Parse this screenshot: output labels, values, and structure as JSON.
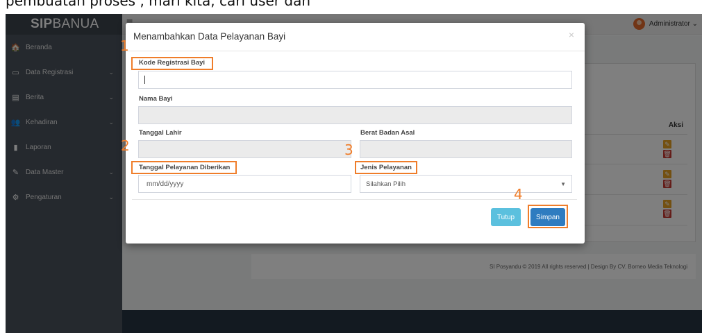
{
  "caption": "pembuatan proses , mari kita, cari user dan",
  "brand": {
    "bold": "SIP",
    "light": "BANUA"
  },
  "sidebar": {
    "items": [
      {
        "label": "Beranda",
        "icon": "home-icon",
        "glyph": "🏠",
        "has_children": false
      },
      {
        "label": "Data Registrasi",
        "icon": "monitor-icon",
        "glyph": "▭",
        "has_children": true
      },
      {
        "label": "Berita",
        "icon": "newspaper-icon",
        "glyph": "▤",
        "has_children": true
      },
      {
        "label": "Kehadiran",
        "icon": "users-icon",
        "glyph": "👥",
        "has_children": true
      },
      {
        "label": "Laporan",
        "icon": "file-icon",
        "glyph": "▮",
        "has_children": false
      },
      {
        "label": "Data Master",
        "icon": "edit-icon",
        "glyph": "✎",
        "has_children": true
      },
      {
        "label": "Pengaturan",
        "icon": "gear-icon",
        "glyph": "⚙",
        "has_children": true
      }
    ],
    "chevron": "⌄"
  },
  "topbar": {
    "menu_glyph": "≡",
    "user": "Administrator ⌄"
  },
  "table": {
    "aksi_header": "Aksi",
    "edit_glyph": "✎",
    "delete_glyph": "🗑"
  },
  "footer": {
    "text": "SI Posyandu © 2019 All rights reserved | Design By CV. Borneo Media Teknologi"
  },
  "modal": {
    "title": "Menambahkan Data Pelayanan Bayi",
    "close": "×",
    "fields": {
      "kode_label": "Kode Registrasi Bayi",
      "kode_value": "",
      "nama_label": "Nama Bayi",
      "tgl_lahir_label": "Tanggal Lahir",
      "berat_label": "Berat Badan Asal",
      "tgl_pelayanan_label": "Tanggal Pelayanan Diberikan",
      "tgl_pelayanan_placeholder": "mm/dd/yyyy",
      "jenis_label": "Jenis Pelayanan",
      "jenis_selected": "Silahkan Pilih",
      "select_arrow": "▼"
    },
    "buttons": {
      "close": "Tutup",
      "save": "Simpan"
    }
  },
  "annotations": {
    "n1": "1",
    "n2": "2",
    "n3": "3",
    "n4": "4"
  },
  "colors": {
    "annotation": "#ef7d2a",
    "sidebar": "#4a525c",
    "primary": "#2f7cc0",
    "info": "#5bc0de"
  }
}
